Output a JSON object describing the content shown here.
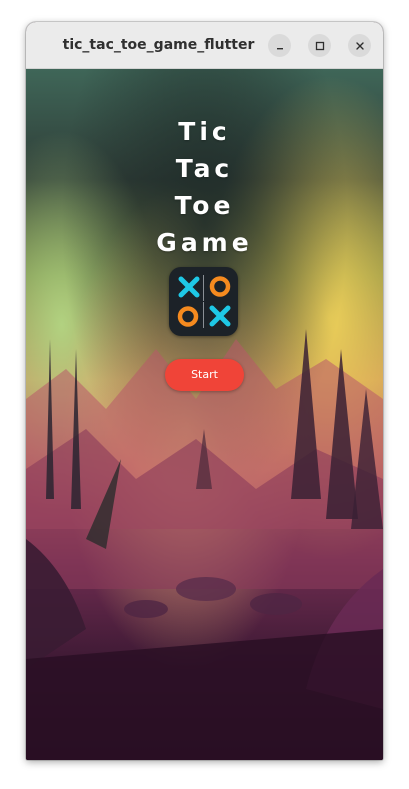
{
  "window": {
    "title": "tic_tac_toe_game_flutter",
    "controls": [
      "minimize-icon",
      "maximize-icon",
      "close-icon"
    ]
  },
  "game": {
    "title_lines": [
      "Tic",
      "Tac",
      "Toe",
      "Game"
    ],
    "start_label": "Start"
  },
  "colors": {
    "start_button": "#f04438",
    "logo_background": "#1c2228",
    "logo_x": "#1ec8e6",
    "logo_o": "#f58a1f",
    "titlebar": "#ebebeb"
  }
}
